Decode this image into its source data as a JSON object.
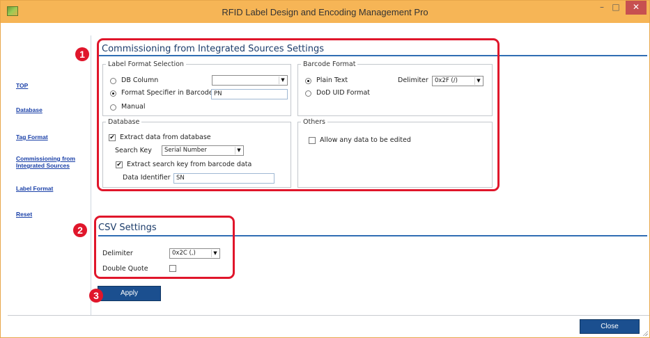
{
  "window": {
    "title": "RFID Label Design and Encoding Management Pro",
    "minimize": "–",
    "maximize": "□",
    "close": "✕"
  },
  "sidebar": {
    "items": [
      {
        "label": "TOP"
      },
      {
        "label": "Database"
      },
      {
        "label": "Tag Format"
      },
      {
        "label": "Commissioning from\nIntegrated Sources"
      },
      {
        "label": "Label Format"
      },
      {
        "label": "Reset"
      }
    ]
  },
  "commissioning": {
    "title": "Commissioning from Integrated Sources Settings",
    "label_format": {
      "legend": "Label Format Selection",
      "db_column_label": "DB Column",
      "db_column_value": "",
      "format_specifier_label": "Format Specifier in Barcode",
      "format_specifier_value": "PN",
      "manual_label": "Manual",
      "selected": "Format Specifier in Barcode"
    },
    "barcode_format": {
      "legend": "Barcode Format",
      "plain_text_label": "Plain Text",
      "dod_uid_label": "DoD UID Format",
      "selected": "Plain Text",
      "delimiter_label": "Delimiter",
      "delimiter_value": "0x2F (/)"
    },
    "database": {
      "legend": "Database",
      "extract_label": "Extract data from database",
      "extract_checked": true,
      "search_key_label": "Search Key",
      "search_key_value": "Serial Number",
      "extract_key_label": "Extract search key from barcode data",
      "extract_key_checked": true,
      "data_identifier_label": "Data Identifier",
      "data_identifier_value": "SN"
    },
    "others": {
      "legend": "Others",
      "allow_edit_label": "Allow any data to be edited",
      "allow_edit_checked": false
    }
  },
  "csv": {
    "title": "CSV Settings",
    "delimiter_label": "Delimiter",
    "delimiter_value": "0x2C (,)",
    "double_quote_label": "Double Quote",
    "double_quote_checked": false
  },
  "buttons": {
    "apply": "Apply",
    "close": "Close"
  },
  "annotations": {
    "badge1": "1",
    "badge2": "2",
    "badge3": "3"
  },
  "colors": {
    "titlebar": "#f6b556",
    "accent_rule": "#2f6db3",
    "button": "#1b4f8f",
    "highlight": "#e0162b",
    "link": "#1a40a8"
  }
}
